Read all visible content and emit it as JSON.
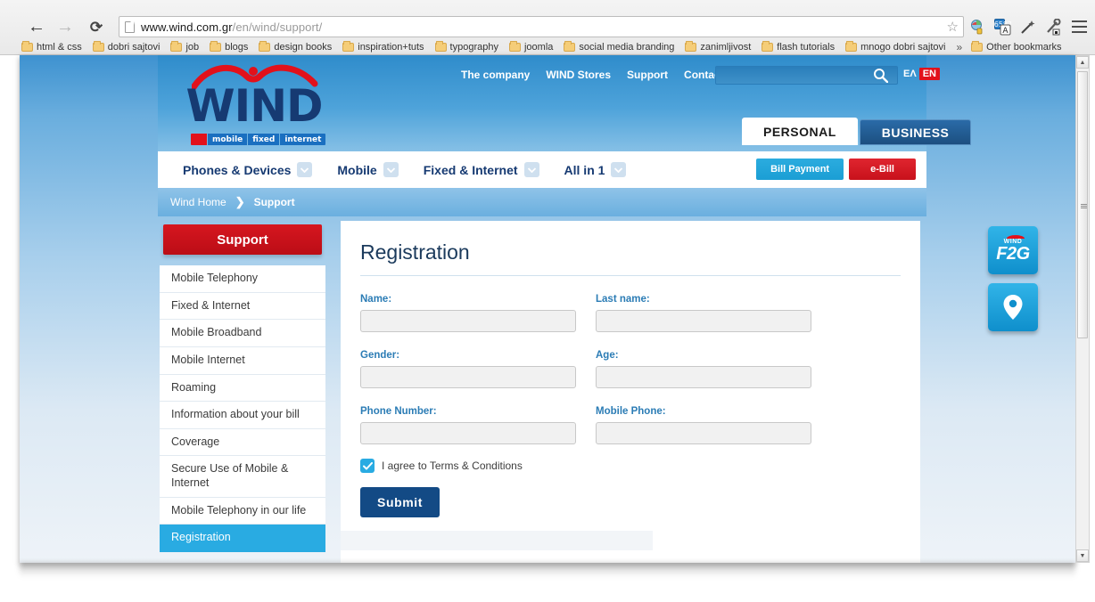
{
  "browser": {
    "url_prefix": "www.wind.com.gr",
    "url_path": "/en/wind/support/",
    "back_glyph": "←",
    "forward_glyph": "→",
    "reload_glyph": "⟳",
    "star_glyph": "☆",
    "bookmarks": [
      "html & css",
      "dobri sajtovi",
      "job",
      "blogs",
      "design books",
      "inspiration+tuts",
      "typography",
      "joomla",
      "social media branding",
      "zanimljivost",
      "flash tutorials",
      "mnogo dobri sajtovi"
    ],
    "overflow_glyph": "»",
    "other_bookmarks": "Other bookmarks",
    "scroll_up_glyph": "▲",
    "scroll_down_glyph": "▼"
  },
  "site": {
    "logo": {
      "wordmark": "WIND",
      "tagline": [
        "mobile",
        "fixed",
        "internet"
      ]
    },
    "topnav": [
      {
        "label": "The company"
      },
      {
        "label": "WIND Stores"
      },
      {
        "label": "Support"
      },
      {
        "label": "Contact Us"
      }
    ],
    "search": {
      "value": "",
      "placeholder": ""
    },
    "languages": {
      "el": "ΕΛ",
      "en": "ΕΝ"
    },
    "tabs": [
      {
        "label": "PERSONAL",
        "active": true
      },
      {
        "label": "BUSINESS",
        "active": false
      }
    ],
    "mainnav": [
      {
        "label": "Phones & Devices"
      },
      {
        "label": "Mobile"
      },
      {
        "label": "Fixed & Internet"
      },
      {
        "label": "All in 1"
      }
    ],
    "actions": {
      "bill_payment": "Bill Payment",
      "ebill": "e-Bill"
    },
    "breadcrumb": {
      "home": "Wind Home",
      "separator": "❯",
      "current": "Support"
    },
    "sidebar": {
      "header": "Support",
      "items": [
        {
          "label": "Mobile Telephony",
          "active": false
        },
        {
          "label": "Fixed & Internet",
          "active": false
        },
        {
          "label": "Mobile Broadband",
          "active": false
        },
        {
          "label": "Mobile Internet",
          "active": false
        },
        {
          "label": "Roaming",
          "active": false
        },
        {
          "label": "Information about your bill",
          "active": false
        },
        {
          "label": "Coverage",
          "active": false
        },
        {
          "label": "Secure Use of Mobile & Internet",
          "active": false
        },
        {
          "label": "Mobile Telephony in our life",
          "active": false
        },
        {
          "label": "Registration",
          "active": true
        }
      ]
    },
    "main": {
      "title": "Registration",
      "fields": [
        {
          "label": "Name:",
          "value": "",
          "placeholder": ""
        },
        {
          "label": "Last name:",
          "value": "",
          "placeholder": ""
        },
        {
          "label": "Gender:",
          "value": "",
          "placeholder": ""
        },
        {
          "label": "Age:",
          "value": "",
          "placeholder": ""
        },
        {
          "label": "Phone Number:",
          "value": "",
          "placeholder": ""
        },
        {
          "label": "Mobile Phone:",
          "value": "",
          "placeholder": ""
        }
      ],
      "agree_label": "I agree to Terms & Conditions",
      "agree_checked": true,
      "check_glyph": "✓",
      "submit_label": "Submit"
    },
    "floaters": [
      {
        "name": "wind-f2g",
        "small": "WIND",
        "big": "F2G"
      },
      {
        "name": "location-pin",
        "small": "",
        "big": ""
      }
    ]
  },
  "colors": {
    "brand_red": "#d6161f",
    "brand_blue": "#163a72",
    "accent_cyan": "#29abe2",
    "submit_blue": "#134a85"
  }
}
